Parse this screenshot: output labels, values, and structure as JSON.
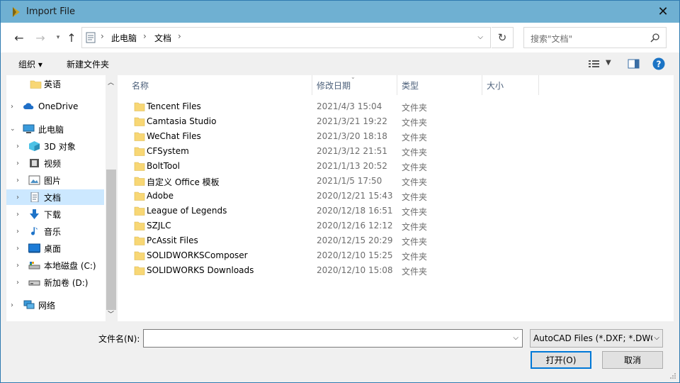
{
  "window": {
    "title": "Import File",
    "close_glyph": "✕"
  },
  "nav": {
    "back": "←",
    "forward": "→",
    "up": "↑",
    "crumbs": [
      "此电脑",
      "文档"
    ],
    "crumb_sep": "›",
    "refresh": "↻",
    "search_placeholder": "搜索\"文档\""
  },
  "toolbar": {
    "organize": "组织 ▾",
    "new_folder": "新建文件夹",
    "help": "?"
  },
  "sidebar": {
    "items": [
      {
        "label": "英语",
        "icon": "folder-icon"
      },
      {
        "label": "OneDrive",
        "icon": "cloud-icon"
      },
      {
        "label": "此电脑",
        "icon": "computer-icon"
      },
      {
        "label": "3D 对象",
        "icon": "cube-icon"
      },
      {
        "label": "视频",
        "icon": "video-icon"
      },
      {
        "label": "图片",
        "icon": "picture-icon"
      },
      {
        "label": "文档",
        "icon": "document-icon"
      },
      {
        "label": "下载",
        "icon": "download-icon"
      },
      {
        "label": "音乐",
        "icon": "music-icon"
      },
      {
        "label": "桌面",
        "icon": "desktop-icon"
      },
      {
        "label": "本地磁盘 (C:)",
        "icon": "disk-icon"
      },
      {
        "label": "新加卷 (D:)",
        "icon": "drive-icon"
      },
      {
        "label": "网络",
        "icon": "network-icon"
      }
    ]
  },
  "columns": {
    "name": "名称",
    "date": "修改日期",
    "type": "类型",
    "size": "大小"
  },
  "files": [
    {
      "name": "Tencent Files",
      "date": "2021/4/3 15:04",
      "type": "文件夹"
    },
    {
      "name": "Camtasia Studio",
      "date": "2021/3/21 19:22",
      "type": "文件夹"
    },
    {
      "name": "WeChat Files",
      "date": "2021/3/20 18:18",
      "type": "文件夹"
    },
    {
      "name": "CFSystem",
      "date": "2021/3/12 21:51",
      "type": "文件夹"
    },
    {
      "name": "BoltTool",
      "date": "2021/1/13 20:52",
      "type": "文件夹"
    },
    {
      "name": "自定义 Office 模板",
      "date": "2021/1/5 17:50",
      "type": "文件夹"
    },
    {
      "name": "Adobe",
      "date": "2020/12/21 15:43",
      "type": "文件夹"
    },
    {
      "name": "League of Legends",
      "date": "2020/12/18 16:51",
      "type": "文件夹"
    },
    {
      "name": "SZJLC",
      "date": "2020/12/16 12:12",
      "type": "文件夹"
    },
    {
      "name": "PcAssit Files",
      "date": "2020/12/15 20:29",
      "type": "文件夹"
    },
    {
      "name": "SOLIDWORKSComposer",
      "date": "2020/12/10 15:25",
      "type": "文件夹"
    },
    {
      "name": "SOLIDWORKS Downloads",
      "date": "2020/12/10 15:08",
      "type": "文件夹"
    }
  ],
  "bottom": {
    "filename_label": "文件名(N):",
    "filename_value": "",
    "filetype_value": "AutoCAD Files (*.DXF; *.DWG",
    "open": "打开(O)",
    "cancel": "取消"
  },
  "colors": {
    "titlebar": "#6fb0d2",
    "selection": "#cce8ff",
    "folder": "#f8d775",
    "accent": "#0078d7"
  }
}
